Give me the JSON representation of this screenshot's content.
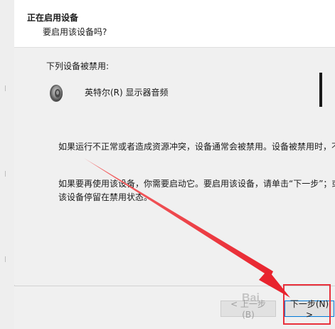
{
  "header": {
    "title": "正在启用设备",
    "subtitle": "要启用该设备吗?"
  },
  "content": {
    "list_caption": "下列设备被禁用:",
    "device": {
      "name": "英特尔(R) 显示器音频",
      "icon": "speaker-icon"
    },
    "paragraph1": "如果运行不正常或者造成资源冲突，设备通常会被禁用。设备被禁用时，不",
    "paragraph2_line1": "如果要再使用该设备，你需要启动它。要启用该设备，请单击“下一步”；或",
    "paragraph2_line2": "该设备停留在禁用状态。"
  },
  "footer": {
    "back_label": "< 上一步(B)",
    "next_label": "下一步(N) >"
  },
  "watermark": "Bai"
}
